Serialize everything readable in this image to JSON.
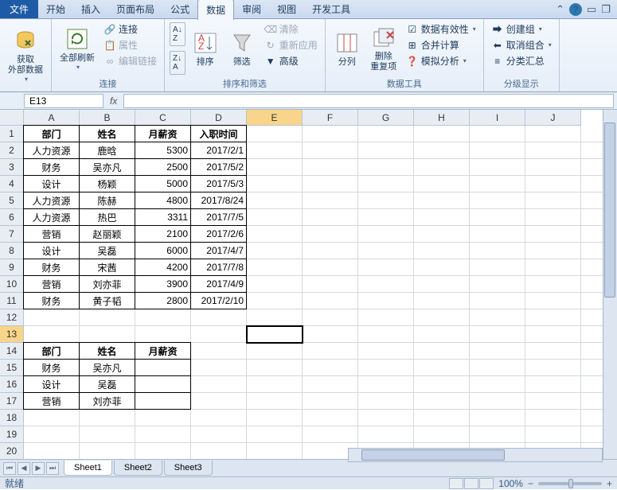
{
  "tabs": {
    "file": "文件",
    "home": "开始",
    "insert": "插入",
    "layout": "页面布局",
    "formula": "公式",
    "data": "数据",
    "review": "审阅",
    "view": "视图",
    "dev": "开发工具"
  },
  "ribbon": {
    "get_data": "获取\n外部数据",
    "refresh": "全部刷新",
    "connections": "连接",
    "properties": "属性",
    "edit_links": "编辑链接",
    "conn_group": "连接",
    "sort_asc": "A↓Z",
    "sort_desc": "Z↓A",
    "sort": "排序",
    "filter": "筛选",
    "clear": "清除",
    "reapply": "重新应用",
    "advanced": "高级",
    "sort_filter_group": "排序和筛选",
    "text_to_col": "分列",
    "remove_dup": "删除\n重复项",
    "data_valid": "数据有效性",
    "consolidate": "合并计算",
    "what_if": "模拟分析",
    "data_tools_group": "数据工具",
    "group": "创建组",
    "ungroup": "取消组合",
    "subtotal": "分类汇总",
    "outline_group": "分级显示"
  },
  "name_box": "E13",
  "fx": "fx",
  "cols": [
    "A",
    "B",
    "C",
    "D",
    "E",
    "F",
    "G",
    "H",
    "I",
    "J"
  ],
  "rows": [
    "1",
    "2",
    "3",
    "4",
    "5",
    "6",
    "7",
    "8",
    "9",
    "10",
    "11",
    "12",
    "13",
    "14",
    "15",
    "16",
    "17",
    "18",
    "19",
    "20"
  ],
  "chart_data": {
    "type": "table",
    "main": {
      "headers": [
        "部门",
        "姓名",
        "月薪资",
        "入职时间"
      ],
      "rows": [
        [
          "人力资源",
          "鹿晗",
          "5300",
          "2017/2/1"
        ],
        [
          "财务",
          "吴亦凡",
          "2500",
          "2017/5/2"
        ],
        [
          "设计",
          "杨颖",
          "5000",
          "2017/5/3"
        ],
        [
          "人力资源",
          "陈赫",
          "4800",
          "2017/8/24"
        ],
        [
          "人力资源",
          "热巴",
          "3311",
          "2017/7/5"
        ],
        [
          "营销",
          "赵丽颖",
          "2100",
          "2017/2/6"
        ],
        [
          "设计",
          "吴磊",
          "6000",
          "2017/4/7"
        ],
        [
          "财务",
          "宋茜",
          "4200",
          "2017/7/8"
        ],
        [
          "营销",
          "刘亦菲",
          "3900",
          "2017/4/9"
        ],
        [
          "财务",
          "黄子韬",
          "2800",
          "2017/2/10"
        ]
      ]
    },
    "lookup": {
      "headers": [
        "部门",
        "姓名",
        "月薪资"
      ],
      "rows": [
        [
          "财务",
          "吴亦凡",
          ""
        ],
        [
          "设计",
          "吴磊",
          ""
        ],
        [
          "营销",
          "刘亦菲",
          ""
        ]
      ]
    }
  },
  "sheets": [
    "Sheet1",
    "Sheet2",
    "Sheet3"
  ],
  "status": "就绪",
  "zoom": "100%"
}
